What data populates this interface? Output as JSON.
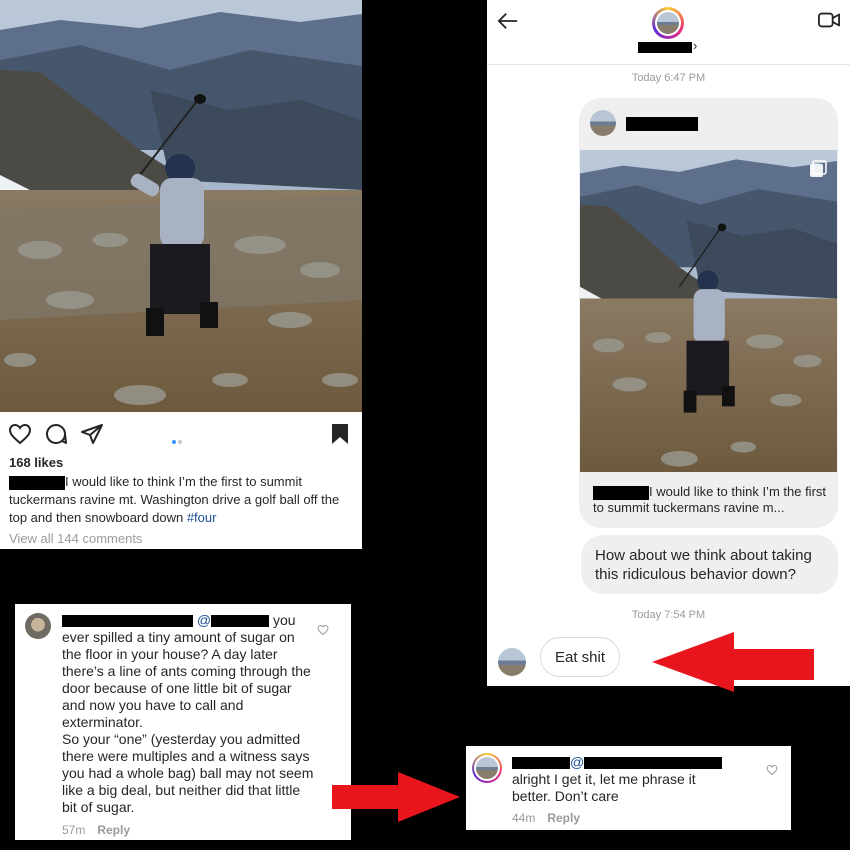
{
  "post": {
    "likes": "168 likes",
    "caption": "I would like to think I’m the first to summit tuckermans ravine mt. Washington drive a golf ball off the top and then snowboard down",
    "hashtag": "#four",
    "view_comments": "View all 144 comments",
    "icons": [
      "heart-icon",
      "comment-icon",
      "share-icon",
      "bookmark-icon"
    ],
    "carousel_dots": 2
  },
  "dm": {
    "timestamp_1": "Today 6:47 PM",
    "shared_caption": "I would like to think I’m the first to summit tuckermans ravine m...",
    "message_out": "How about we think about taking this ridiculous behavior down?",
    "timestamp_2": "Today 7:54 PM",
    "message_in": "Eat shit",
    "chevron": "›"
  },
  "comment1": {
    "mention_at": "@",
    "text_suffix": "you",
    "body": "ever spilled a tiny amount of sugar on the floor in your house? A day later there’s a line of ants coming through the door because of one little bit of sugar and now you have to call and exterminator.",
    "body2": "So your “one” (yesterday you admitted there were multiples and a witness says you had a whole bag) ball may not seem like a big deal, but neither did that little bit of sugar.",
    "time": "57m",
    "reply": "Reply"
  },
  "comment2": {
    "mention_at": "@",
    "body": "alright I get it, let me phrase it better. Don’t care",
    "time": "44m",
    "reply": "Reply"
  },
  "colors": {
    "hashtag": "#1e4f94",
    "dot_active": "#3897f0",
    "dot_inactive": "#c7c7c7",
    "arrow_red": "#e8161c",
    "bubble_gray": "#efefef"
  }
}
